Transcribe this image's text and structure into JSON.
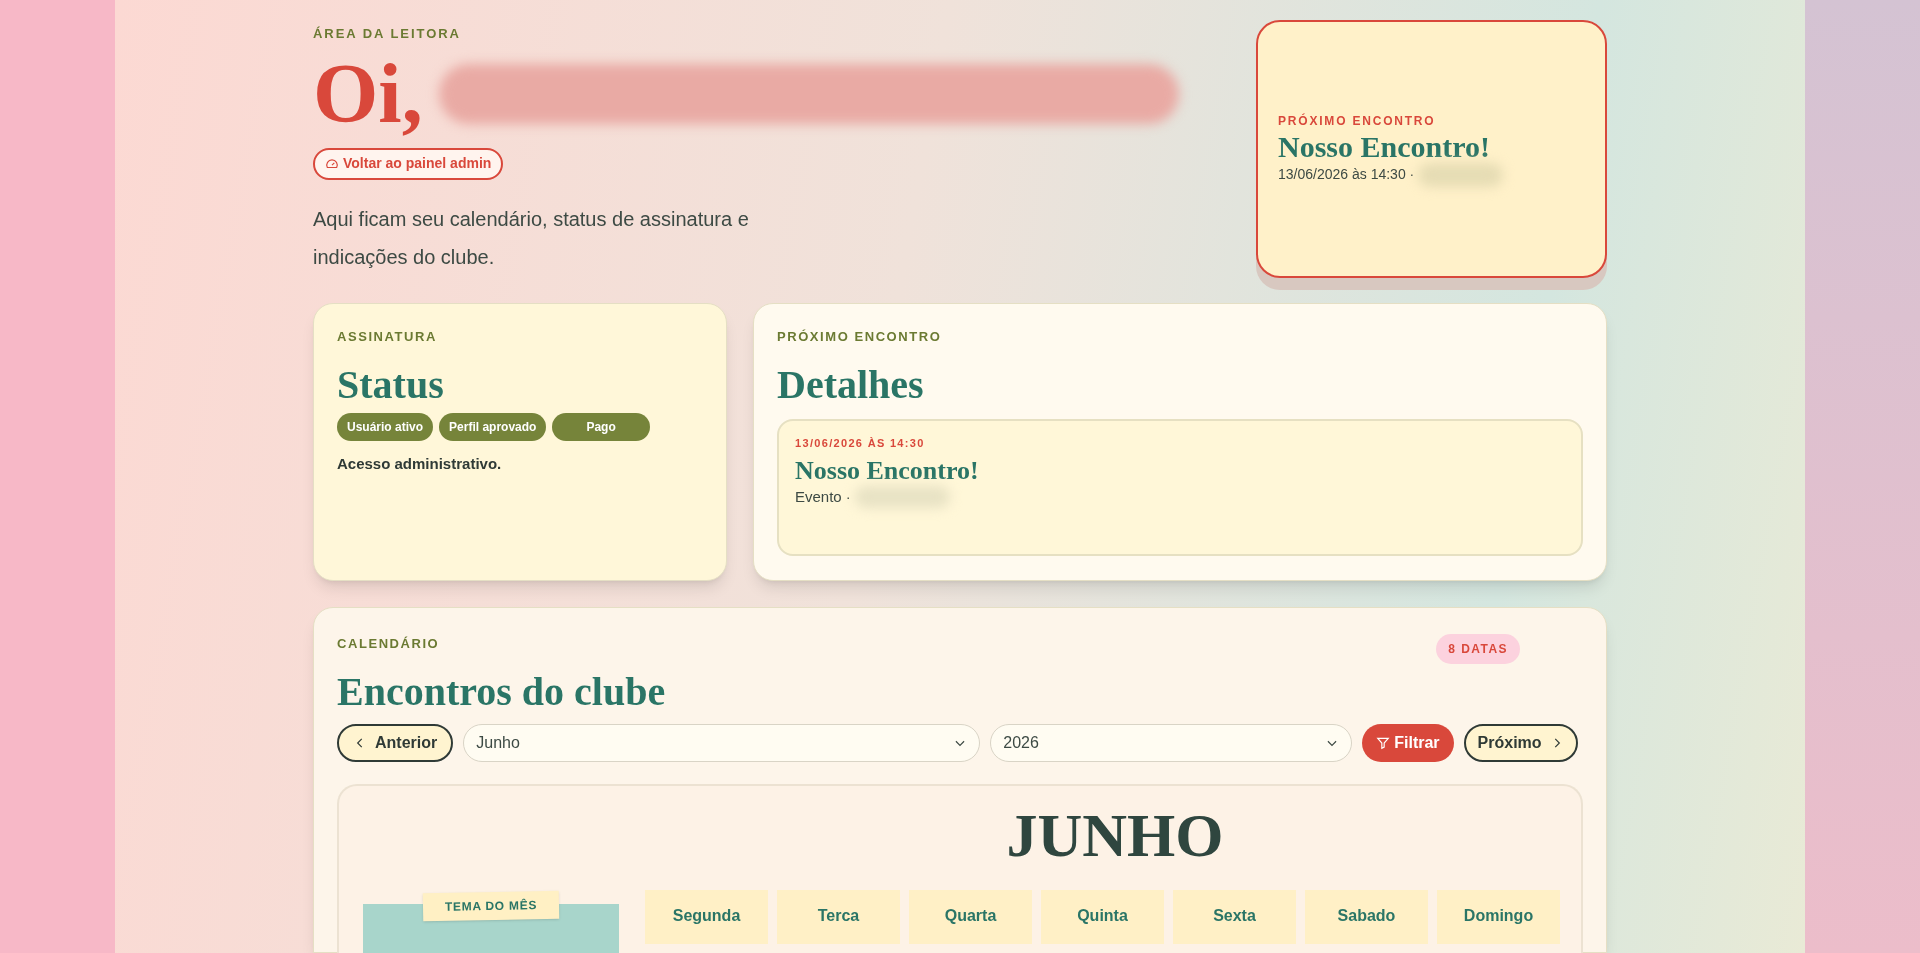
{
  "header": {
    "eyebrow": "ÁREA DA LEITORA",
    "greeting": "Oi,",
    "name_redacted": true,
    "admin_button": "Voltar ao painel admin",
    "intro": "Aqui ficam seu calendário, status de assinatura e indicações do clube."
  },
  "next_card": {
    "eyebrow": "PRÓXIMO ENCONTRO",
    "title": "Nosso Encontro!",
    "meta": "13/06/2026 às 14:30 ·",
    "location_redacted": true
  },
  "subscription": {
    "eyebrow": "ASSINATURA",
    "title": "Status",
    "badges": [
      "Usuário ativo",
      "Perfil aprovado",
      "Pago"
    ],
    "note": "Acesso administrativo."
  },
  "details": {
    "eyebrow": "PRÓXIMO ENCONTRO",
    "title": "Detalhes",
    "event": {
      "date": "13/06/2026 ÀS 14:30",
      "title": "Nosso Encontro!",
      "meta": "Evento ·",
      "location_redacted": true
    }
  },
  "calendar": {
    "eyebrow": "CALENDÁRIO",
    "title": "Encontros do clube",
    "count": "8 DATAS",
    "prev": "Anterior",
    "month": "Junho",
    "year": "2026",
    "filter": "Filtrar",
    "next": "Próximo",
    "month_title": "JUNHO",
    "theme_tag": "TEMA DO MÊS",
    "weekdays": [
      "Segunda",
      "Terca",
      "Quarta",
      "Quinta",
      "Sexta",
      "Sabado",
      "Domingo"
    ]
  }
}
